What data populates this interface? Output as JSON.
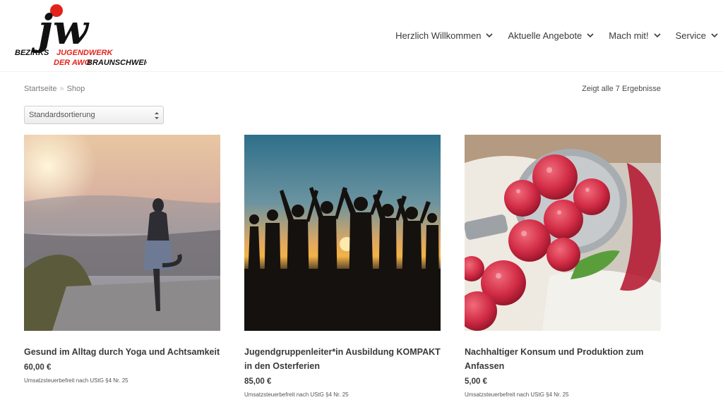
{
  "brand": {
    "logo_big": "jw",
    "line1_left": "BEZIRKS",
    "line1_right": "JUGENDWERK",
    "line2_left": "DER AWO",
    "line2_right": "BRAUNSCHWEIG",
    "accent": "#e2231a"
  },
  "nav": {
    "items": [
      {
        "label": "Herzlich Willkommen"
      },
      {
        "label": "Aktuelle Angebote"
      },
      {
        "label": "Mach mit!"
      },
      {
        "label": "Service"
      }
    ]
  },
  "breadcrumb": {
    "home": "Startseite",
    "separator": "»",
    "current": "Shop"
  },
  "result_count": "Zeigt alle 7 Ergebnisse",
  "sort": {
    "selected": "Standardsortierung"
  },
  "products": [
    {
      "title": "Gesund im Alltag durch Yoga und Achtsamkeit",
      "price": "60,00 €",
      "tax_note": "Umsatzsteuerbefreit nach UStG §4 Nr. 25",
      "image": "yoga-sunset-photo"
    },
    {
      "title": "Jugendgruppenleiter*in Ausbildung KOMPAKT in den Osterferien",
      "price": "85,00 €",
      "tax_note": "Umsatzsteuerbefreit nach UStG §4 Nr. 25",
      "image": "group-silhouette-sunset-photo"
    },
    {
      "title": "Nachhaltiger Konsum und Produktion zum Anfassen",
      "price": "5,00 €",
      "tax_note": "Umsatzsteuerbefreit nach UStG §4 Nr. 25",
      "image": "raspberries-photo"
    }
  ]
}
